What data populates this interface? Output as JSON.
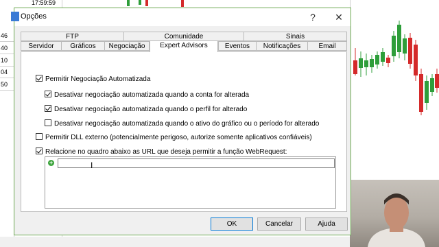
{
  "background": {
    "time_label": "17:59:59",
    "left_cells": [
      "46",
      "40",
      "10",
      "04",
      "50"
    ]
  },
  "dialog": {
    "title": "Opções",
    "help_icon": "?",
    "close_icon": "✕"
  },
  "tabs": {
    "row1": [
      "FTP",
      "Comunidade",
      "Sinais"
    ],
    "row2": [
      "Servidor",
      "Gráficos",
      "Negociação",
      "Expert Advisors",
      "Eventos",
      "Notificações",
      "Email"
    ],
    "active": "Expert Advisors"
  },
  "options": {
    "allow_auto_trading": {
      "label": "Permitir Negociação Automatizada",
      "checked": true
    },
    "disable_on_account_change": {
      "label": "Desativar negociação automatizada quando a conta for alterada",
      "checked": true
    },
    "disable_on_profile_change": {
      "label": "Desativar negociação automatizada quando o perfil for alterado",
      "checked": true
    },
    "disable_on_symbol_change": {
      "label": "Desativar negociação automatizada quando o ativo do gráfico ou o período for alterado",
      "checked": false
    },
    "allow_dll": {
      "label": "Permitir DLL externo (potencialmente perigoso, autorize somente aplicativos confiáveis)",
      "checked": false
    },
    "allow_webrequest": {
      "label": "Relacione no quadro abaixo as URL que deseja permitir a função WebRequest:",
      "checked": true
    }
  },
  "url_list": {
    "add_icon": "plus-circle-icon",
    "input_value": ""
  },
  "buttons": {
    "ok": "OK",
    "cancel": "Cancelar",
    "help": "Ajuda"
  },
  "colors": {
    "dialog_border": "#6aa84f",
    "candle_up": "#2e9e3a",
    "candle_down": "#d42a2a",
    "default_button_border": "#0078d7"
  }
}
